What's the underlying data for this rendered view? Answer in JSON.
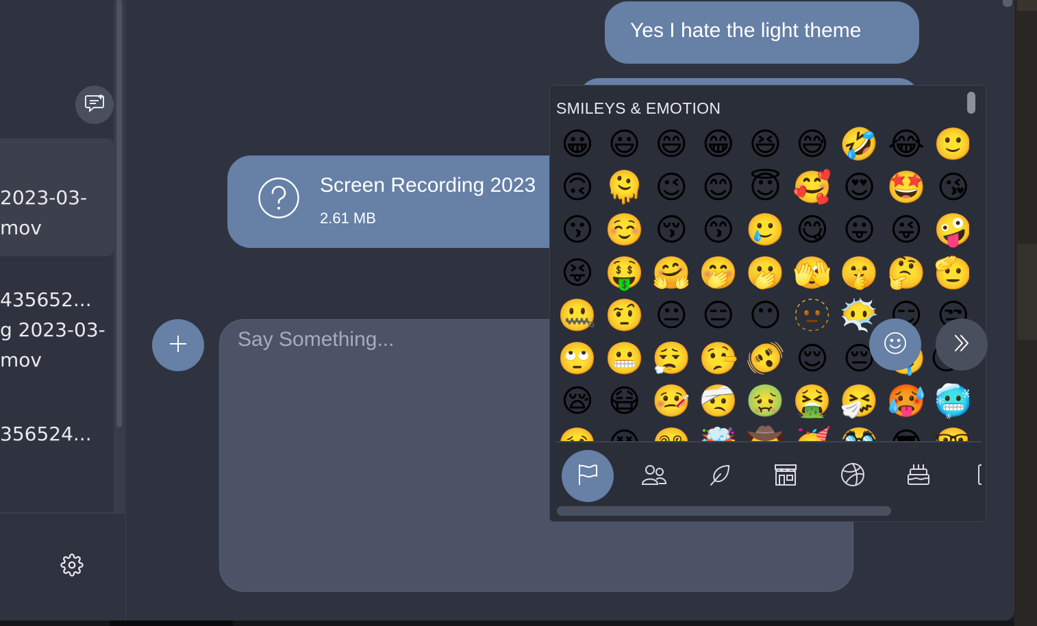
{
  "sidebar": {
    "conversations": [
      {
        "line1": "2023-03-",
        "line2": "mov"
      },
      {
        "line1": "435652...",
        "line2": "g 2023-03-",
        "line3": "mov"
      },
      {
        "line1": "356524..."
      }
    ],
    "icons": {
      "new_chat": "new-chat-icon",
      "settings": "gear-icon"
    }
  },
  "chat": {
    "messages": [
      {
        "type": "text",
        "text": "Yes I hate the light theme"
      },
      {
        "type": "file",
        "name": "Screen Recording 2023",
        "size": "2.61 MB",
        "icon": "question-circle-icon"
      }
    ],
    "composer": {
      "placeholder": "Say Something..."
    }
  },
  "emoji_picker": {
    "category_title": "SMILEYS & EMOTION",
    "emojis": [
      "😀",
      "😃",
      "😄",
      "😁",
      "😆",
      "😅",
      "🤣",
      "😂",
      "🙂",
      "🙃",
      "🫠",
      "😉",
      "😊",
      "😇",
      "🥰",
      "😍",
      "🤩",
      "😘",
      "😗",
      "☺️",
      "😚",
      "😙",
      "🥲",
      "😋",
      "😛",
      "😜",
      "🤪",
      "😝",
      "🤑",
      "🤗",
      "🤭",
      "🫢",
      "🫣",
      "🤫",
      "🤔",
      "🫡",
      "🤐",
      "🤨",
      "😐",
      "😑",
      "😶",
      "🫥",
      "😶‍🌫️",
      "😏",
      "😒",
      "🙄",
      "😬",
      "😮‍💨",
      "🤥",
      "🫨",
      "😌",
      "😔",
      "🤤",
      "😴",
      "😪",
      "😷",
      "🤒",
      "🤕",
      "🤢",
      "🤮",
      "🤧",
      "🥵",
      "🥶",
      "🥴",
      "😵",
      "😵‍💫",
      "🤯",
      "🤠",
      "🥳",
      "🥸",
      "😎",
      "🤓"
    ],
    "categories": [
      "flag-icon",
      "people-icon",
      "leaf-icon",
      "store-icon",
      "basketball-icon",
      "cake-icon",
      "object-icon"
    ],
    "active_category": "flag-icon",
    "buttons": {
      "emoji_toggle": "smiley-icon",
      "send": "double-chevron-right-icon"
    }
  },
  "colors": {
    "background": "#2f3340",
    "accent": "#6680a6",
    "composer": "#4d5366",
    "picker": "#2a2e39"
  }
}
